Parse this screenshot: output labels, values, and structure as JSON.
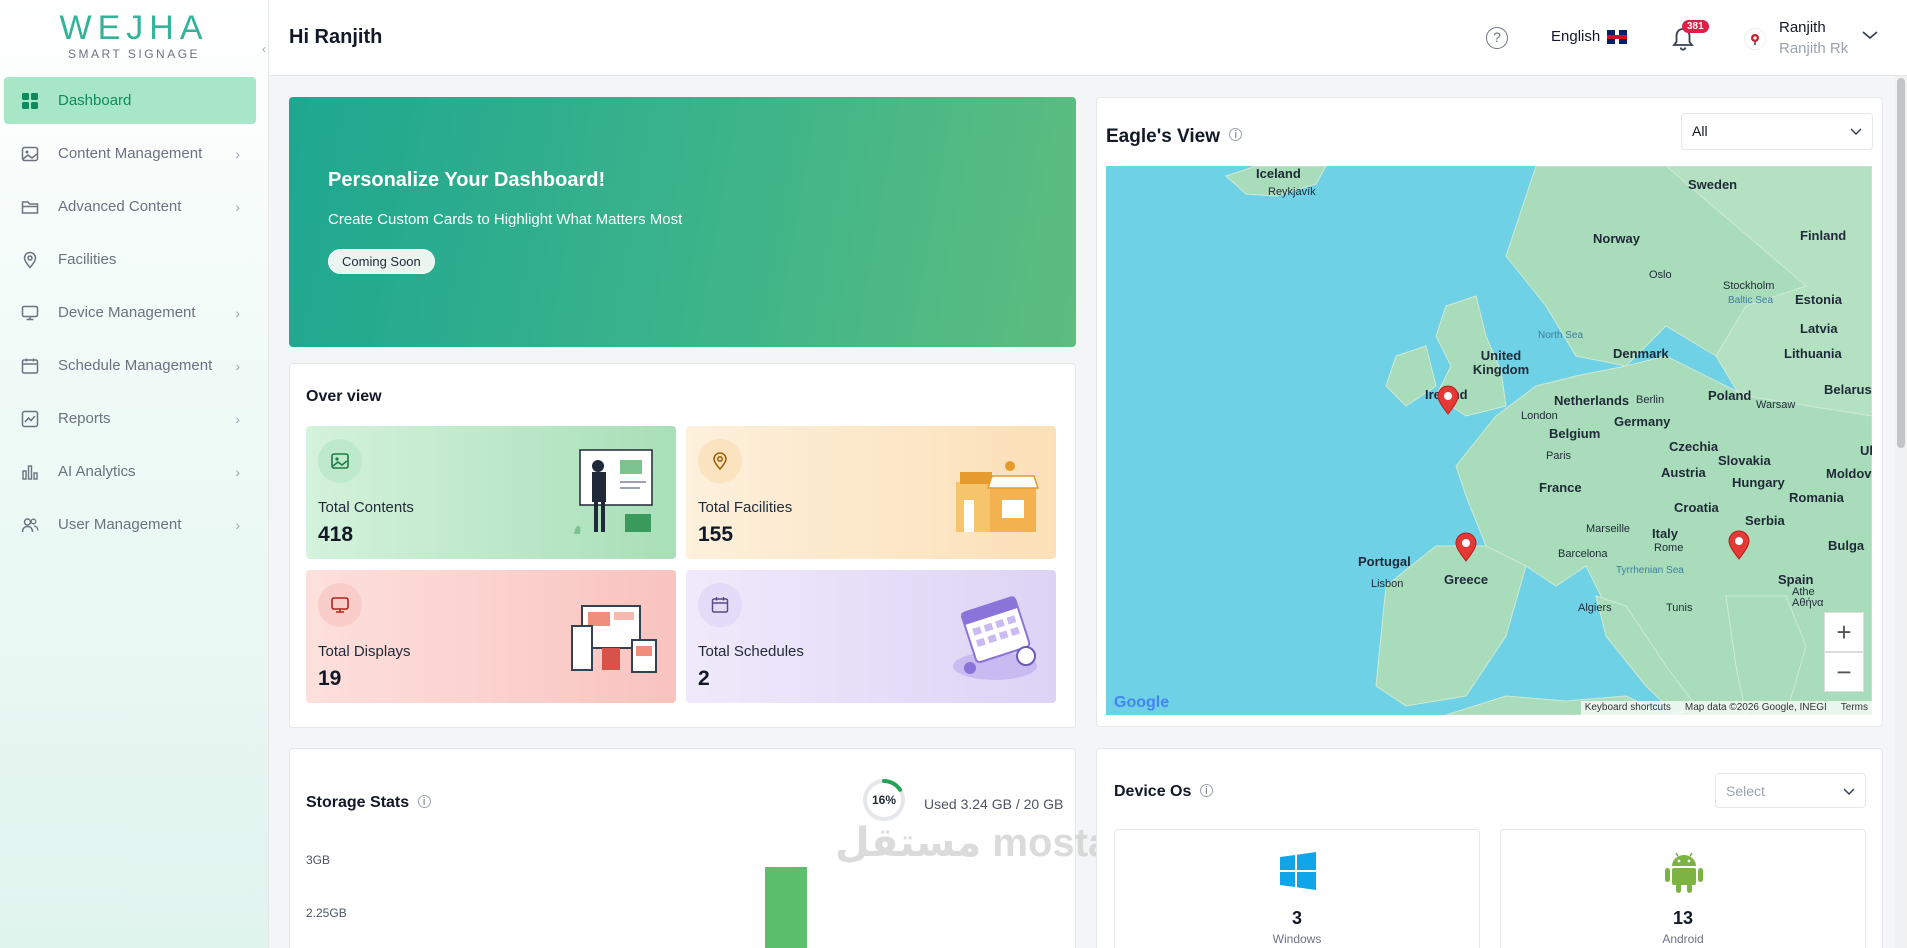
{
  "sidebar": {
    "logo_word": "WEJHA",
    "logo_sub": "SMART SIGNAGE",
    "items": [
      {
        "label": "Dashboard",
        "icon": "grid-icon"
      },
      {
        "label": "Content Management",
        "icon": "image-icon"
      },
      {
        "label": "Advanced Content",
        "icon": "folder-icon"
      },
      {
        "label": "Facilities",
        "icon": "location-pin-icon"
      },
      {
        "label": "Device Management",
        "icon": "monitor-icon"
      },
      {
        "label": "Schedule Management",
        "icon": "calendar-icon"
      },
      {
        "label": "Reports",
        "icon": "report-chart-icon"
      },
      {
        "label": "AI Analytics",
        "icon": "bar-chart-icon"
      },
      {
        "label": "User Management",
        "icon": "users-icon"
      }
    ]
  },
  "header": {
    "greeting": "Hi Ranjith",
    "language": "English",
    "notification_count": "381",
    "user_name": "Ranjith",
    "user_sub": "Ranjith Rk"
  },
  "banner": {
    "title": "Personalize Your Dashboard!",
    "subtitle": "Create Custom Cards to Highlight What Matters Most",
    "badge": "Coming Soon"
  },
  "overview": {
    "title": "Over view",
    "stats": [
      {
        "label": "Total Contents",
        "value": "418",
        "color": "#a8dfb8"
      },
      {
        "label": "Total Facilities",
        "value": "155",
        "color": "#fbe0b7"
      },
      {
        "label": "Total Displays",
        "value": "19",
        "color": "#f9c3bf"
      },
      {
        "label": "Total Schedules",
        "value": "2",
        "color": "#ddd3f5"
      }
    ]
  },
  "eagle": {
    "title": "Eagle's View",
    "filter": "All",
    "map_labels": {
      "countries": [
        "Iceland",
        "Sweden",
        "Norway",
        "Finland",
        "Estonia",
        "Latvia",
        "Denmark",
        "Lithuania",
        "United Kingdom",
        "Ireland",
        "Netherlands",
        "Belarus",
        "Poland",
        "Germany",
        "Belgium",
        "Czechia",
        "Slovakia",
        "Uk",
        "Austria",
        "Moldova",
        "France",
        "Hungary",
        "Romania",
        "Croatia",
        "Serbia",
        "Italy",
        "Bulga",
        "Portugal",
        "Spain",
        "Greece"
      ],
      "cities": [
        "Reykjavík",
        "Oslo",
        "Stockholm",
        "London",
        "Berlin",
        "Warsaw",
        "Paris",
        "Marseille",
        "Barcelona",
        "Rome",
        "Lisbon",
        "Algiers",
        "Tunis",
        "Athe",
        "Aθήνα"
      ],
      "seas": [
        "North Sea",
        "Baltic Sea",
        "Tyrrhenian Sea"
      ]
    },
    "map_footer": {
      "shortcuts": "Keyboard shortcuts",
      "data": "Map data ©2026 Google, INEGI",
      "terms": "Terms"
    },
    "google": "Google",
    "zoom_in": "+",
    "zoom_out": "−"
  },
  "storage": {
    "title": "Storage Stats",
    "percent": "16%",
    "percent_value": 0.16,
    "used": "Used 3.24 GB / 20 GB",
    "y_ticks": [
      "3GB",
      "2.25GB"
    ]
  },
  "device_os": {
    "title": "Device Os",
    "select_placeholder": "Select",
    "items": [
      {
        "count": "3",
        "label": "Windows"
      },
      {
        "count": "13",
        "label": "Android"
      }
    ]
  },
  "watermark": "مستقل mostaql.com"
}
